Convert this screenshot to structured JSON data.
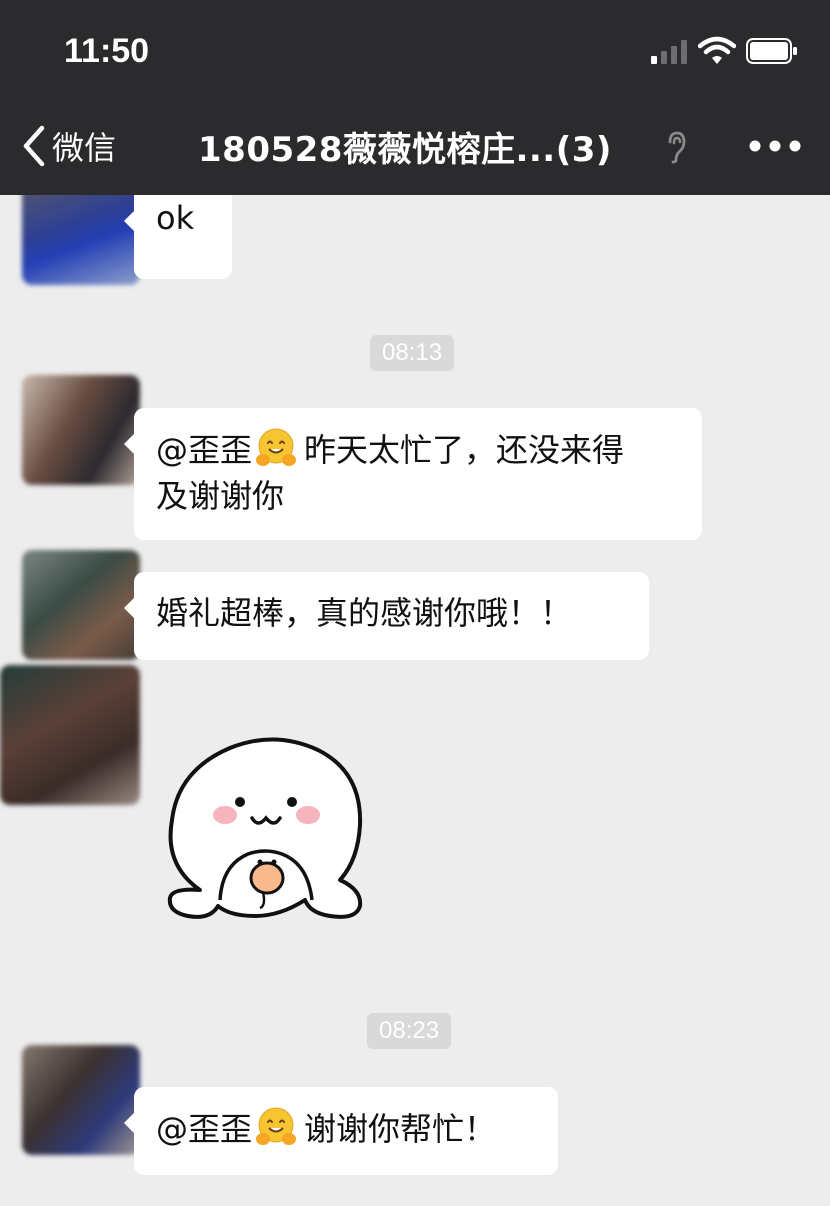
{
  "status_bar": {
    "time": "11:50"
  },
  "header": {
    "back_label": "微信",
    "title": "180528薇薇悦榕庄...(3)"
  },
  "messages": [
    {
      "type": "text",
      "text": "ok"
    },
    {
      "type": "time",
      "text": "08:13"
    },
    {
      "type": "text",
      "mention": "@歪歪",
      "line1": "昨天太忙了，还没来得",
      "line2": "及谢谢你"
    },
    {
      "type": "text",
      "text": "婚礼超棒，真的感谢你哦！！"
    },
    {
      "type": "sticker",
      "icon": "cute-bun-sticker"
    },
    {
      "type": "time",
      "text": "08:23"
    },
    {
      "type": "text",
      "mention": "@歪歪",
      "text_after": "谢谢你帮忙！"
    }
  ],
  "colors": {
    "header_bg": "#2b2b2d",
    "chat_bg": "#ededed",
    "bubble_bg": "#ffffff",
    "time_badge_bg": "#d9d9d9"
  }
}
